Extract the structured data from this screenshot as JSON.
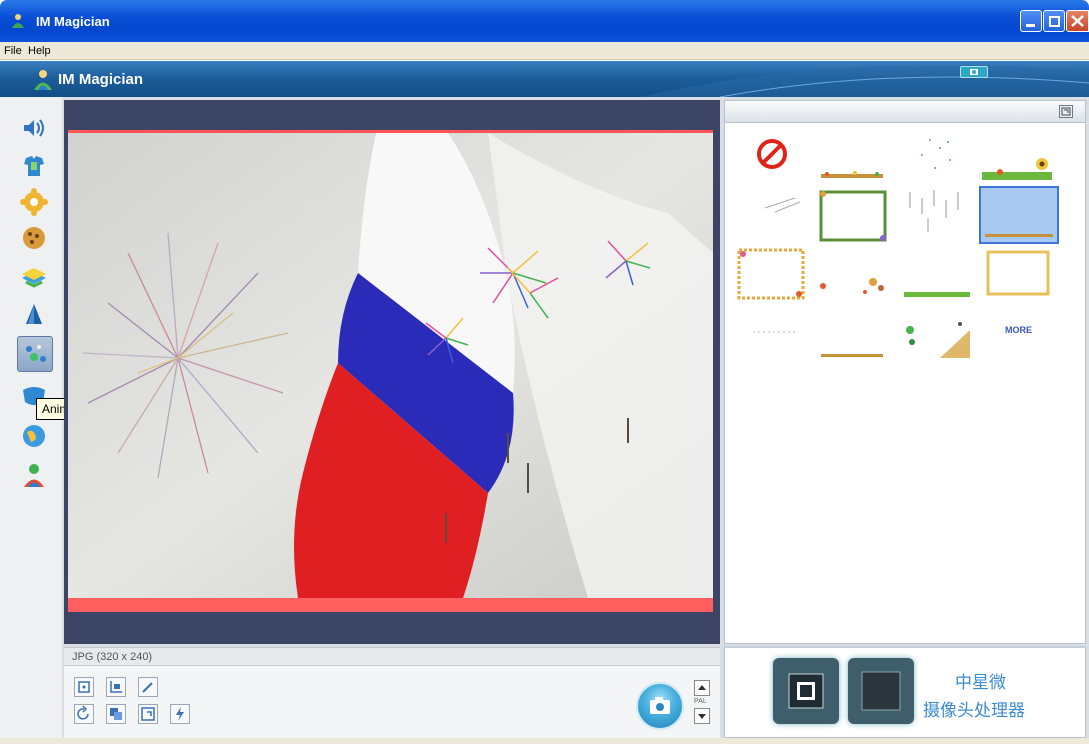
{
  "window": {
    "title": "IM Magician"
  },
  "menu": {
    "items": [
      "File",
      "Help"
    ]
  },
  "header": {
    "title": "IM Magician"
  },
  "toolstrip": {
    "tools": [
      "sound",
      "clothes",
      "gear",
      "cookie",
      "layers",
      "sail",
      "animation",
      "mask",
      "globe",
      "person"
    ],
    "tooltip": "Animation"
  },
  "preview": {
    "format_label": "JPG (320 x 240)"
  },
  "controls": {
    "pal_label": "PAL"
  },
  "effects": {
    "more_label": "MORE"
  },
  "logo": {
    "line1": "中星微",
    "line2": "摄像头处理器"
  },
  "colors": {
    "frame_red": "#ff5454",
    "accent_blue": "#3c8bd3",
    "panel_navy": "#3c4566"
  }
}
